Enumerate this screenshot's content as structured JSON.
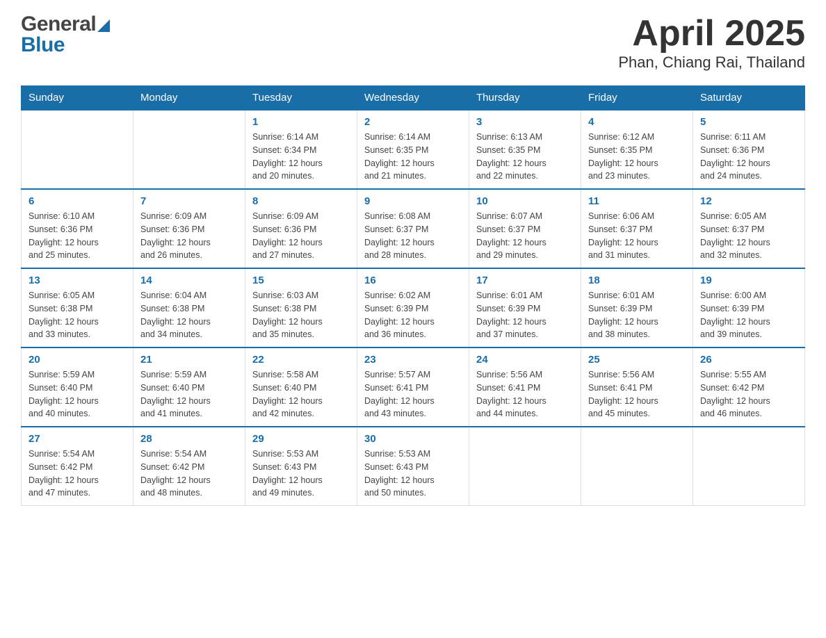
{
  "header": {
    "logo_general": "General",
    "logo_blue": "Blue",
    "title": "April 2025",
    "subtitle": "Phan, Chiang Rai, Thailand"
  },
  "calendar": {
    "days_of_week": [
      "Sunday",
      "Monday",
      "Tuesday",
      "Wednesday",
      "Thursday",
      "Friday",
      "Saturday"
    ],
    "weeks": [
      [
        {
          "day": "",
          "info": ""
        },
        {
          "day": "",
          "info": ""
        },
        {
          "day": "1",
          "info": "Sunrise: 6:14 AM\nSunset: 6:34 PM\nDaylight: 12 hours\nand 20 minutes."
        },
        {
          "day": "2",
          "info": "Sunrise: 6:14 AM\nSunset: 6:35 PM\nDaylight: 12 hours\nand 21 minutes."
        },
        {
          "day": "3",
          "info": "Sunrise: 6:13 AM\nSunset: 6:35 PM\nDaylight: 12 hours\nand 22 minutes."
        },
        {
          "day": "4",
          "info": "Sunrise: 6:12 AM\nSunset: 6:35 PM\nDaylight: 12 hours\nand 23 minutes."
        },
        {
          "day": "5",
          "info": "Sunrise: 6:11 AM\nSunset: 6:36 PM\nDaylight: 12 hours\nand 24 minutes."
        }
      ],
      [
        {
          "day": "6",
          "info": "Sunrise: 6:10 AM\nSunset: 6:36 PM\nDaylight: 12 hours\nand 25 minutes."
        },
        {
          "day": "7",
          "info": "Sunrise: 6:09 AM\nSunset: 6:36 PM\nDaylight: 12 hours\nand 26 minutes."
        },
        {
          "day": "8",
          "info": "Sunrise: 6:09 AM\nSunset: 6:36 PM\nDaylight: 12 hours\nand 27 minutes."
        },
        {
          "day": "9",
          "info": "Sunrise: 6:08 AM\nSunset: 6:37 PM\nDaylight: 12 hours\nand 28 minutes."
        },
        {
          "day": "10",
          "info": "Sunrise: 6:07 AM\nSunset: 6:37 PM\nDaylight: 12 hours\nand 29 minutes."
        },
        {
          "day": "11",
          "info": "Sunrise: 6:06 AM\nSunset: 6:37 PM\nDaylight: 12 hours\nand 31 minutes."
        },
        {
          "day": "12",
          "info": "Sunrise: 6:05 AM\nSunset: 6:37 PM\nDaylight: 12 hours\nand 32 minutes."
        }
      ],
      [
        {
          "day": "13",
          "info": "Sunrise: 6:05 AM\nSunset: 6:38 PM\nDaylight: 12 hours\nand 33 minutes."
        },
        {
          "day": "14",
          "info": "Sunrise: 6:04 AM\nSunset: 6:38 PM\nDaylight: 12 hours\nand 34 minutes."
        },
        {
          "day": "15",
          "info": "Sunrise: 6:03 AM\nSunset: 6:38 PM\nDaylight: 12 hours\nand 35 minutes."
        },
        {
          "day": "16",
          "info": "Sunrise: 6:02 AM\nSunset: 6:39 PM\nDaylight: 12 hours\nand 36 minutes."
        },
        {
          "day": "17",
          "info": "Sunrise: 6:01 AM\nSunset: 6:39 PM\nDaylight: 12 hours\nand 37 minutes."
        },
        {
          "day": "18",
          "info": "Sunrise: 6:01 AM\nSunset: 6:39 PM\nDaylight: 12 hours\nand 38 minutes."
        },
        {
          "day": "19",
          "info": "Sunrise: 6:00 AM\nSunset: 6:39 PM\nDaylight: 12 hours\nand 39 minutes."
        }
      ],
      [
        {
          "day": "20",
          "info": "Sunrise: 5:59 AM\nSunset: 6:40 PM\nDaylight: 12 hours\nand 40 minutes."
        },
        {
          "day": "21",
          "info": "Sunrise: 5:59 AM\nSunset: 6:40 PM\nDaylight: 12 hours\nand 41 minutes."
        },
        {
          "day": "22",
          "info": "Sunrise: 5:58 AM\nSunset: 6:40 PM\nDaylight: 12 hours\nand 42 minutes."
        },
        {
          "day": "23",
          "info": "Sunrise: 5:57 AM\nSunset: 6:41 PM\nDaylight: 12 hours\nand 43 minutes."
        },
        {
          "day": "24",
          "info": "Sunrise: 5:56 AM\nSunset: 6:41 PM\nDaylight: 12 hours\nand 44 minutes."
        },
        {
          "day": "25",
          "info": "Sunrise: 5:56 AM\nSunset: 6:41 PM\nDaylight: 12 hours\nand 45 minutes."
        },
        {
          "day": "26",
          "info": "Sunrise: 5:55 AM\nSunset: 6:42 PM\nDaylight: 12 hours\nand 46 minutes."
        }
      ],
      [
        {
          "day": "27",
          "info": "Sunrise: 5:54 AM\nSunset: 6:42 PM\nDaylight: 12 hours\nand 47 minutes."
        },
        {
          "day": "28",
          "info": "Sunrise: 5:54 AM\nSunset: 6:42 PM\nDaylight: 12 hours\nand 48 minutes."
        },
        {
          "day": "29",
          "info": "Sunrise: 5:53 AM\nSunset: 6:43 PM\nDaylight: 12 hours\nand 49 minutes."
        },
        {
          "day": "30",
          "info": "Sunrise: 5:53 AM\nSunset: 6:43 PM\nDaylight: 12 hours\nand 50 minutes."
        },
        {
          "day": "",
          "info": ""
        },
        {
          "day": "",
          "info": ""
        },
        {
          "day": "",
          "info": ""
        }
      ]
    ]
  }
}
